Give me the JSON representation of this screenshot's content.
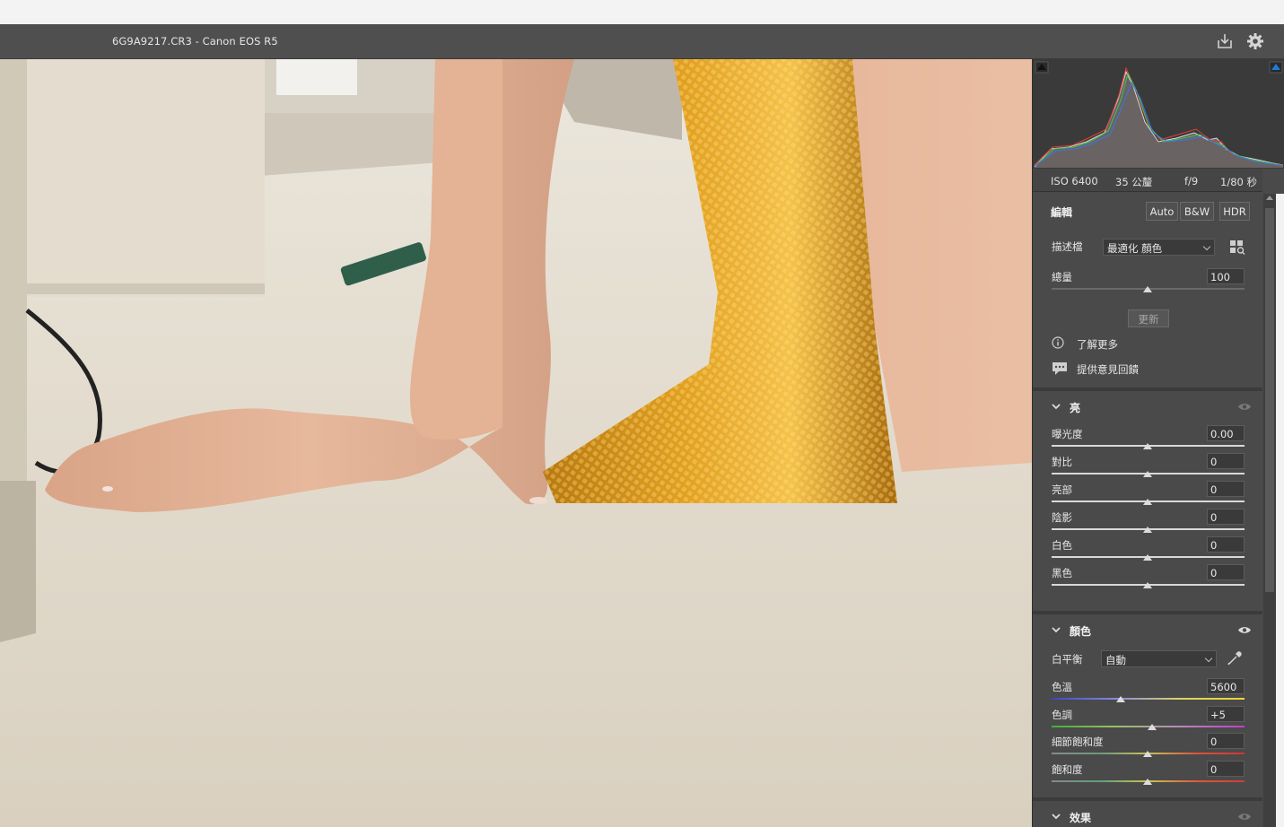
{
  "window": {
    "title": "6G9A9217.CR3  -  Canon EOS R5",
    "icons": [
      "save-icon",
      "gear-icon"
    ]
  },
  "exif": {
    "iso": "ISO 6400",
    "focal": "35 公釐",
    "aperture": "f/9",
    "shutter": "1/80 秒"
  },
  "edit": {
    "title": "編輯",
    "auto_label": "Auto",
    "bw_label": "B&W",
    "hdr_label": "HDR",
    "profile_label": "描述檔",
    "profile_value": "最適化 顏色",
    "amount_label": "總量",
    "amount_value": "100",
    "update_label": "更新",
    "learn_more": "了解更多",
    "feedback": "提供意見回饋"
  },
  "light": {
    "title": "亮",
    "sliders": [
      {
        "label": "曝光度",
        "value": "0.00"
      },
      {
        "label": "對比",
        "value": "0"
      },
      {
        "label": "亮部",
        "value": "0"
      },
      {
        "label": "陰影",
        "value": "0"
      },
      {
        "label": "白色",
        "value": "0"
      },
      {
        "label": "黑色",
        "value": "0"
      }
    ]
  },
  "color": {
    "title": "顏色",
    "wb_label": "白平衡",
    "wb_value": "自動",
    "sliders": [
      {
        "label": "色溫",
        "value": "5600"
      },
      {
        "label": "色調",
        "value": "+5"
      },
      {
        "label": "細節飽和度",
        "value": "0"
      },
      {
        "label": "飽和度",
        "value": "0"
      }
    ]
  },
  "effects": {
    "title": "效果"
  },
  "colors": {
    "panel_bg": "#4a4a4a",
    "title_bar": "#4f4f4f",
    "accent_blue": "#1e7bd6"
  }
}
